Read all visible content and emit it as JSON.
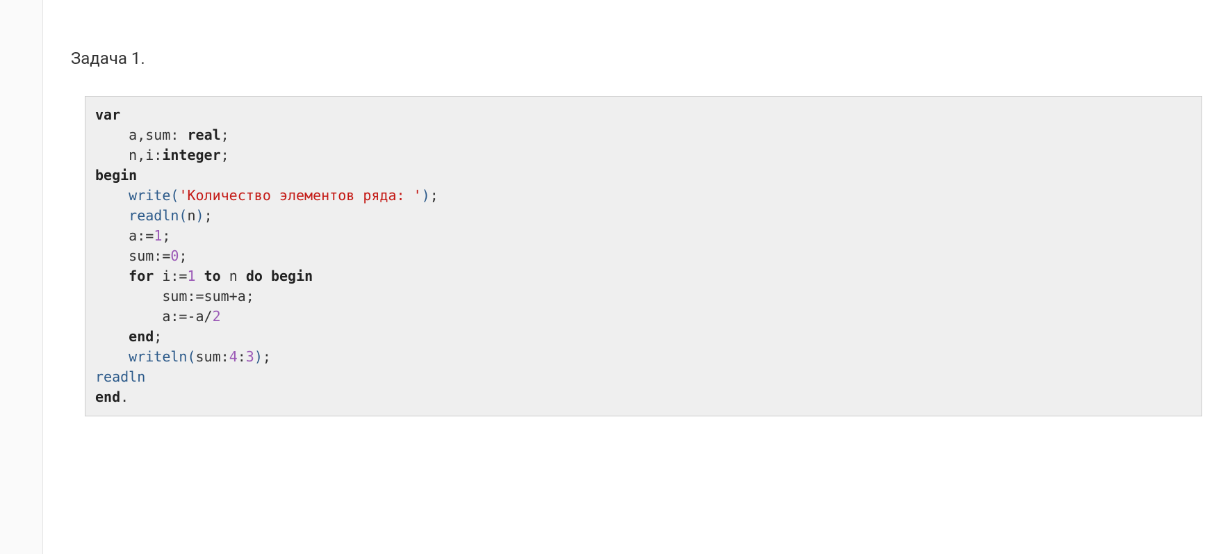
{
  "heading": "Задача 1.",
  "code": {
    "kw_var": "var",
    "kw_real": "real",
    "kw_integer": "integer",
    "kw_begin": "begin",
    "kw_for": "for",
    "kw_to": "to",
    "kw_do": "do",
    "kw_begin2": "begin",
    "kw_end": "end",
    "kw_end2": "end",
    "id_a": "a",
    "id_sum": "sum",
    "id_n": "n",
    "id_i": "i",
    "fn_write": "write",
    "fn_readln": "readln",
    "fn_writeln": "writeln",
    "fn_readln2": "readln",
    "str_prompt": "'Количество элементов ряда: '",
    "num_1": "1",
    "num_0": "0",
    "num_1b": "1",
    "num_2": "2",
    "num_4": "4",
    "num_3": "3",
    "line2_vars": "a,sum",
    "line3_vars": "n,i",
    "line10_vars": "sum:=sum+a",
    "line11_expr": "a:=-a/",
    "line13_arg": "sum:"
  }
}
